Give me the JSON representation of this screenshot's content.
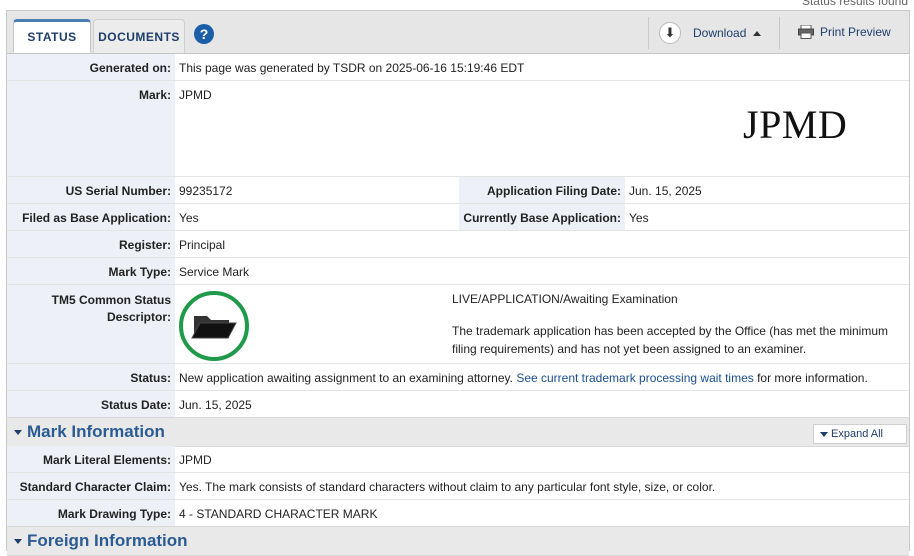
{
  "top_note": "Status results found",
  "tabs": {
    "status": "STATUS",
    "documents": "DOCUMENTS",
    "help": "?"
  },
  "toolbar": {
    "download": "Download",
    "print_preview": "Print Preview"
  },
  "rows": {
    "generated_label": "Generated on:",
    "generated_value": "This page was generated by TSDR on 2025-06-16 15:19:46 EDT",
    "mark_label": "Mark:",
    "mark_value": "JPMD",
    "mark_image_text": "JPMD",
    "serial_label": "US Serial Number:",
    "serial_value": "99235172",
    "filing_date_label": "Application Filing Date:",
    "filing_date_value": "Jun. 15, 2025",
    "filed_base_label": "Filed as Base Application:",
    "filed_base_value": "Yes",
    "current_base_label": "Currently Base Application:",
    "current_base_value": "Yes",
    "register_label": "Register:",
    "register_value": "Principal",
    "mark_type_label": "Mark Type:",
    "mark_type_value": "Service Mark",
    "tm5_label_1": "TM5 Common Status",
    "tm5_label_2": "Descriptor:",
    "tm5_status": "LIVE/APPLICATION/Awaiting Examination",
    "tm5_desc_1": "The trademark application has been accepted by the Office (has met the minimum",
    "tm5_desc_2": "filing requirements) and has not yet been assigned to an examiner.",
    "status_label": "Status:",
    "status_text": "New application awaiting assignment to an examining attorney.",
    "status_link": "See current trademark processing wait times",
    "status_suffix": "for more information.",
    "status_date_label": "Status Date:",
    "status_date_value": "Jun. 15, 2025"
  },
  "mark_info": {
    "title": "Mark Information",
    "expand_all": "Expand All",
    "literal_label": "Mark Literal Elements:",
    "literal_value": "JPMD",
    "std_char_label": "Standard Character Claim:",
    "std_char_value": "Yes. The mark consists of standard characters without claim to any particular font style, size, or color.",
    "drawing_type_label": "Mark Drawing Type:",
    "drawing_type_value": "4 - STANDARD CHARACTER MARK"
  },
  "next_section": "Foreign Information",
  "colors": {
    "accent": "#2a5b94",
    "label_bg": "#edf0f7",
    "status_green": "#1f9a4a",
    "help_blue": "#1a5ea8"
  },
  "icons": [
    "help-icon",
    "download-icon",
    "printer-icon",
    "folder-icon",
    "expand-caret-icon",
    "section-caret-icon"
  ]
}
